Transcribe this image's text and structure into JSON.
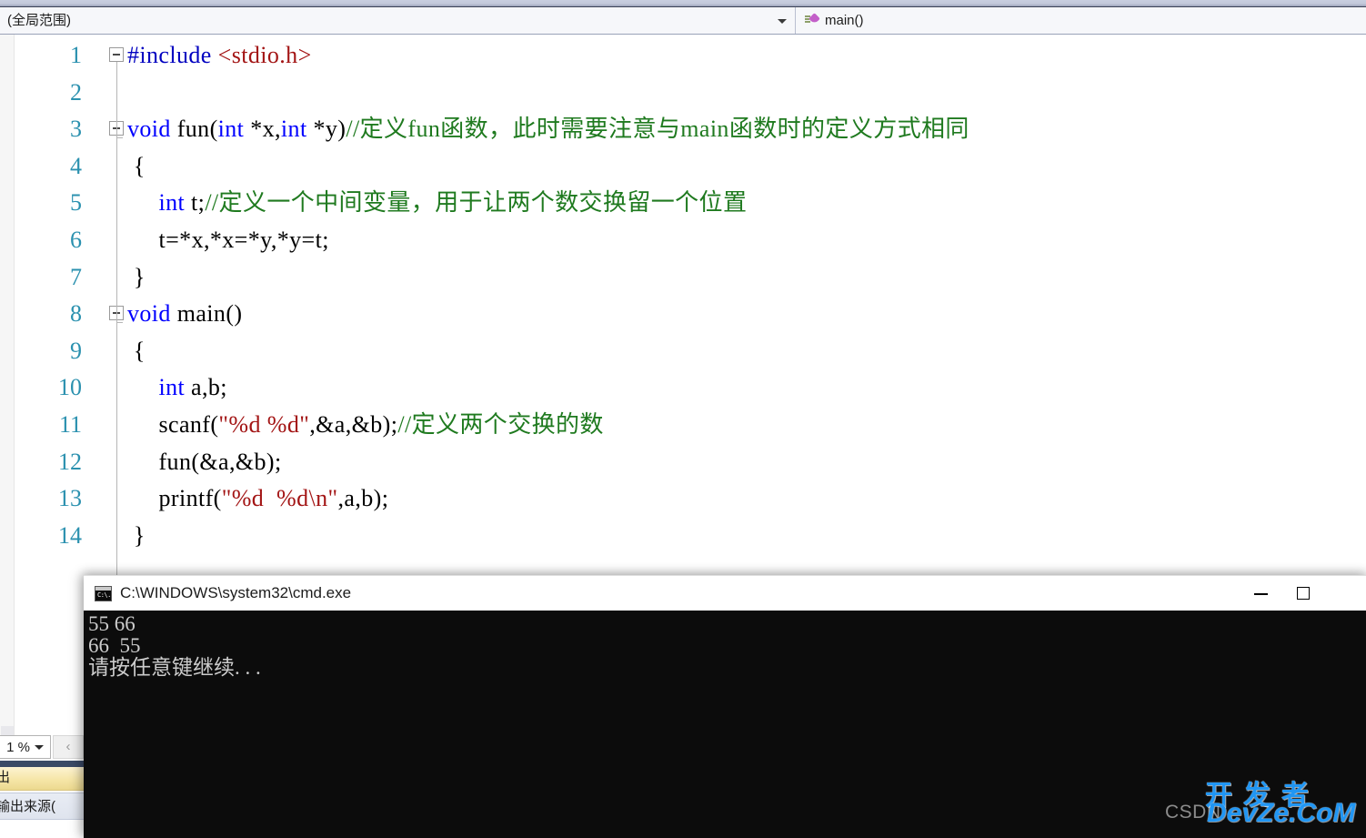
{
  "app": {
    "ide": "Visual Studio",
    "nav_bar": {
      "scope_value": "(全局范围)",
      "member_value": "main()",
      "member_icon": "method-icon"
    }
  },
  "editor": {
    "zoom_value": "1 %",
    "lines": [
      {
        "num": "1",
        "fold": true,
        "indent": 0,
        "tokens": [
          {
            "t": "pp",
            "s": "#include "
          },
          {
            "t": "inc",
            "s": "<stdio.h>"
          }
        ]
      },
      {
        "num": "2",
        "fold": false,
        "indent": 0,
        "tokens": []
      },
      {
        "num": "3",
        "fold": true,
        "indent": 0,
        "tokens": [
          {
            "t": "kw",
            "s": "void"
          },
          {
            "t": "pl",
            "s": " fun("
          },
          {
            "t": "kw",
            "s": "int"
          },
          {
            "t": "pl",
            "s": " *x,"
          },
          {
            "t": "kw",
            "s": "int"
          },
          {
            "t": "pl",
            "s": " *y)"
          },
          {
            "t": "cmt",
            "s": "//定义fun函数，此时需要注意与main函数时的定义方式相同"
          }
        ]
      },
      {
        "num": "4",
        "fold": false,
        "indent": 0,
        "tokens": [
          {
            "t": "pl",
            "s": " {"
          }
        ]
      },
      {
        "num": "5",
        "fold": false,
        "indent": 0,
        "tokens": [
          {
            "t": "pl",
            "s": "     "
          },
          {
            "t": "kw",
            "s": "int"
          },
          {
            "t": "pl",
            "s": " t;"
          },
          {
            "t": "cmt",
            "s": "//定义一个中间变量，用于让两个数交换留一个位置"
          }
        ]
      },
      {
        "num": "6",
        "fold": false,
        "indent": 0,
        "tokens": [
          {
            "t": "pl",
            "s": "     t=*x,*x=*y,*y=t;"
          }
        ]
      },
      {
        "num": "7",
        "fold": false,
        "indent": 0,
        "tokens": [
          {
            "t": "pl",
            "s": " }"
          }
        ]
      },
      {
        "num": "8",
        "fold": true,
        "indent": 0,
        "tokens": [
          {
            "t": "kw",
            "s": "void"
          },
          {
            "t": "pl",
            "s": " main()"
          }
        ]
      },
      {
        "num": "9",
        "fold": false,
        "indent": 0,
        "tokens": [
          {
            "t": "pl",
            "s": " {"
          }
        ]
      },
      {
        "num": "10",
        "fold": false,
        "indent": 0,
        "tokens": [
          {
            "t": "pl",
            "s": "     "
          },
          {
            "t": "kw",
            "s": "int"
          },
          {
            "t": "pl",
            "s": " a,b;"
          }
        ]
      },
      {
        "num": "11",
        "fold": false,
        "indent": 0,
        "tokens": [
          {
            "t": "pl",
            "s": "     scanf("
          },
          {
            "t": "str",
            "s": "\"%d %d\""
          },
          {
            "t": "pl",
            "s": ",&a,&b);"
          },
          {
            "t": "cmt",
            "s": "//定义两个交换的数"
          }
        ]
      },
      {
        "num": "12",
        "fold": false,
        "indent": 0,
        "tokens": [
          {
            "t": "pl",
            "s": "     fun(&a,&b);"
          }
        ]
      },
      {
        "num": "13",
        "fold": false,
        "indent": 0,
        "tokens": [
          {
            "t": "pl",
            "s": "     printf("
          },
          {
            "t": "str",
            "s": "\"%d  %d\\n\""
          },
          {
            "t": "pl",
            "s": ",a,b);"
          }
        ]
      },
      {
        "num": "14",
        "fold": false,
        "indent": 0,
        "tokens": [
          {
            "t": "pl",
            "s": " }"
          }
        ]
      }
    ]
  },
  "output_panel": {
    "tab_label": "输出",
    "source_label": "显示输出来源("
  },
  "console_window": {
    "title": "C:\\WINDOWS\\system32\\cmd.exe",
    "icon": "console-icon",
    "minimize_label": "—",
    "maximize_label": "□",
    "lines": [
      "55 66",
      "66  55",
      "请按任意键继续. . ."
    ]
  },
  "watermark": {
    "csdn": "CSDN",
    "cn": "开发者",
    "en": "DevZe.CoM"
  },
  "colors": {
    "keyword": "#0000ff",
    "string": "#a31515",
    "comment": "#1f7a1f",
    "preprocessor": "#0000c0",
    "line_number": "#2b91af",
    "console_bg": "#0c0c0c",
    "console_fg": "#cccccc",
    "watermark_blue": "#2196f3"
  }
}
